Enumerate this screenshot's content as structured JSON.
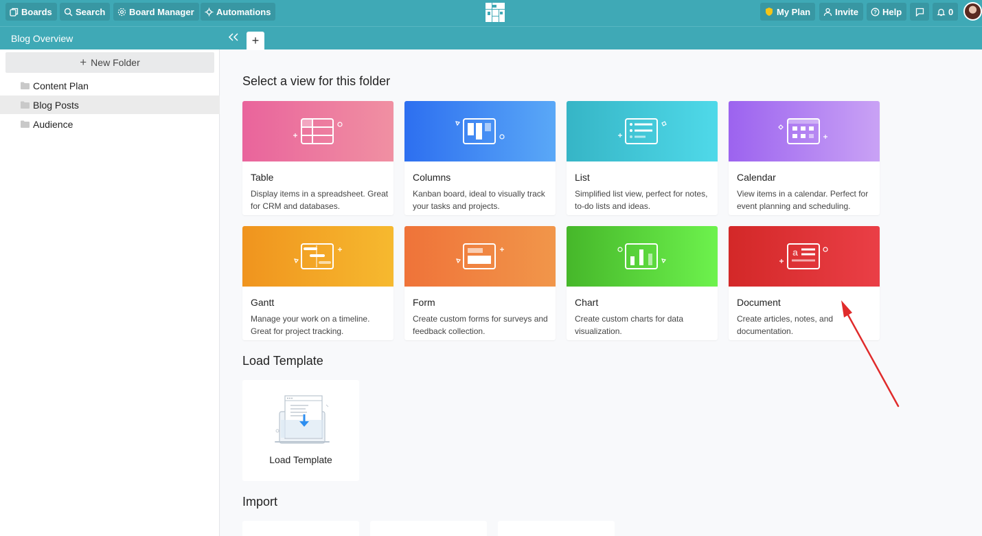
{
  "topbar": {
    "boards": "Boards",
    "search": "Search",
    "board_manager": "Board Manager",
    "automations": "Automations",
    "my_plan": "My Plan",
    "invite": "Invite",
    "help": "Help",
    "notifications_count": "0"
  },
  "board": {
    "title": "Blog Overview",
    "add_tab": "+"
  },
  "sidebar": {
    "new_folder": "New Folder",
    "folders": [
      {
        "label": "Content Plan",
        "active": false
      },
      {
        "label": "Blog Posts",
        "active": true
      },
      {
        "label": "Audience",
        "active": false
      }
    ]
  },
  "main": {
    "views_title": "Select a view for this folder",
    "views": [
      {
        "name": "Table",
        "desc": "Display items in a spreadsheet. Great for CRM and databases.",
        "color_from": "#e9649c",
        "color_to": "#f090a2"
      },
      {
        "name": "Columns",
        "desc": "Kanban board, ideal to visually track your tasks and projects.",
        "color_from": "#2d6ff0",
        "color_to": "#5aa8f7"
      },
      {
        "name": "List",
        "desc": "Simplified list view, perfect for notes, to-do lists and ideas.",
        "color_from": "#36b5c6",
        "color_to": "#4fd9e9"
      },
      {
        "name": "Calendar",
        "desc": "View items in a calendar. Perfect for event planning and scheduling.",
        "color_from": "#9c63ef",
        "color_to": "#c9a2f5"
      },
      {
        "name": "Gantt",
        "desc": "Manage your work on a timeline. Great for project tracking.",
        "color_from": "#f0941e",
        "color_to": "#f6b92f"
      },
      {
        "name": "Form",
        "desc": "Create custom forms for surveys and feedback collection.",
        "color_from": "#ef7339",
        "color_to": "#f1964a"
      },
      {
        "name": "Chart",
        "desc": "Create custom charts for data visualization.",
        "color_from": "#46b72a",
        "color_to": "#6df24d"
      },
      {
        "name": "Document",
        "desc": "Create articles, notes, and documentation.",
        "color_from": "#d32828",
        "color_to": "#ea3f46"
      }
    ],
    "template_title": "Load Template",
    "template_card_label": "Load Template",
    "import_title": "Import"
  },
  "colors": {
    "topbar": "#3fa9b6",
    "annotation_arrow": "#e02b2b"
  }
}
